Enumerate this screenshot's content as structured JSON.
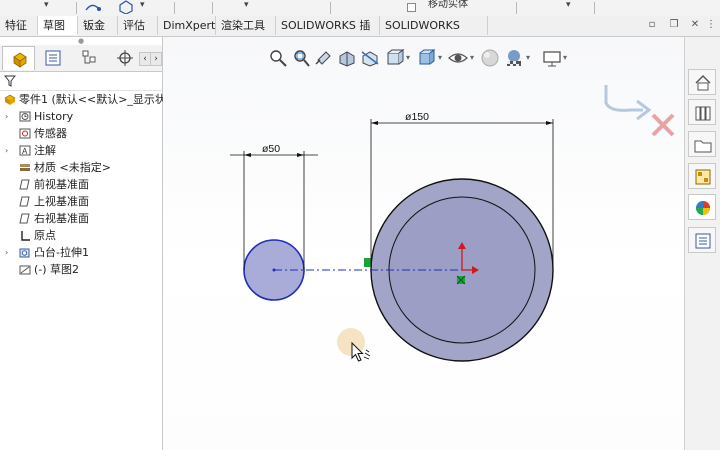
{
  "ribbon_top": {
    "move_body_label": "移动实体"
  },
  "tabs": [
    {
      "label": "特征",
      "active": false
    },
    {
      "label": "草图",
      "active": true
    },
    {
      "label": "钣金",
      "active": false
    },
    {
      "label": "评估",
      "active": false
    },
    {
      "label": "DimXpert",
      "active": false
    },
    {
      "label": "渲染工具",
      "active": false
    },
    {
      "label": "SOLIDWORKS 插件",
      "active": false
    },
    {
      "label": "SOLIDWORKS MBD",
      "active": false
    }
  ],
  "feature_tree": {
    "root": "零件1 (默认<<默认>_显示状",
    "items": [
      {
        "label": "History",
        "icon": "history-icon",
        "expandable": true
      },
      {
        "label": "传感器",
        "icon": "sensor-icon",
        "expandable": false
      },
      {
        "label": "注解",
        "icon": "annotation-icon",
        "expandable": true
      },
      {
        "label": "材质 <未指定>",
        "icon": "material-icon",
        "expandable": false
      },
      {
        "label": "前视基准面",
        "icon": "plane-icon",
        "expandable": false
      },
      {
        "label": "上视基准面",
        "icon": "plane-icon",
        "expandable": false
      },
      {
        "label": "右视基准面",
        "icon": "plane-icon",
        "expandable": false
      },
      {
        "label": "原点",
        "icon": "origin-icon",
        "expandable": false
      },
      {
        "label": "凸台-拉伸1",
        "icon": "extrude-icon",
        "expandable": true
      },
      {
        "label": "(-) 草图2",
        "icon": "sketch-icon",
        "expandable": false
      }
    ]
  },
  "dimensions": {
    "small": "ø50",
    "large": "ø150"
  },
  "colors": {
    "sketch_fill": "#a9abd9",
    "large_fill": "#a3a5c8",
    "accent_blue": "#1f2eb5",
    "origin_red": "#d01a1a",
    "green_marker": "#1aa33a"
  }
}
